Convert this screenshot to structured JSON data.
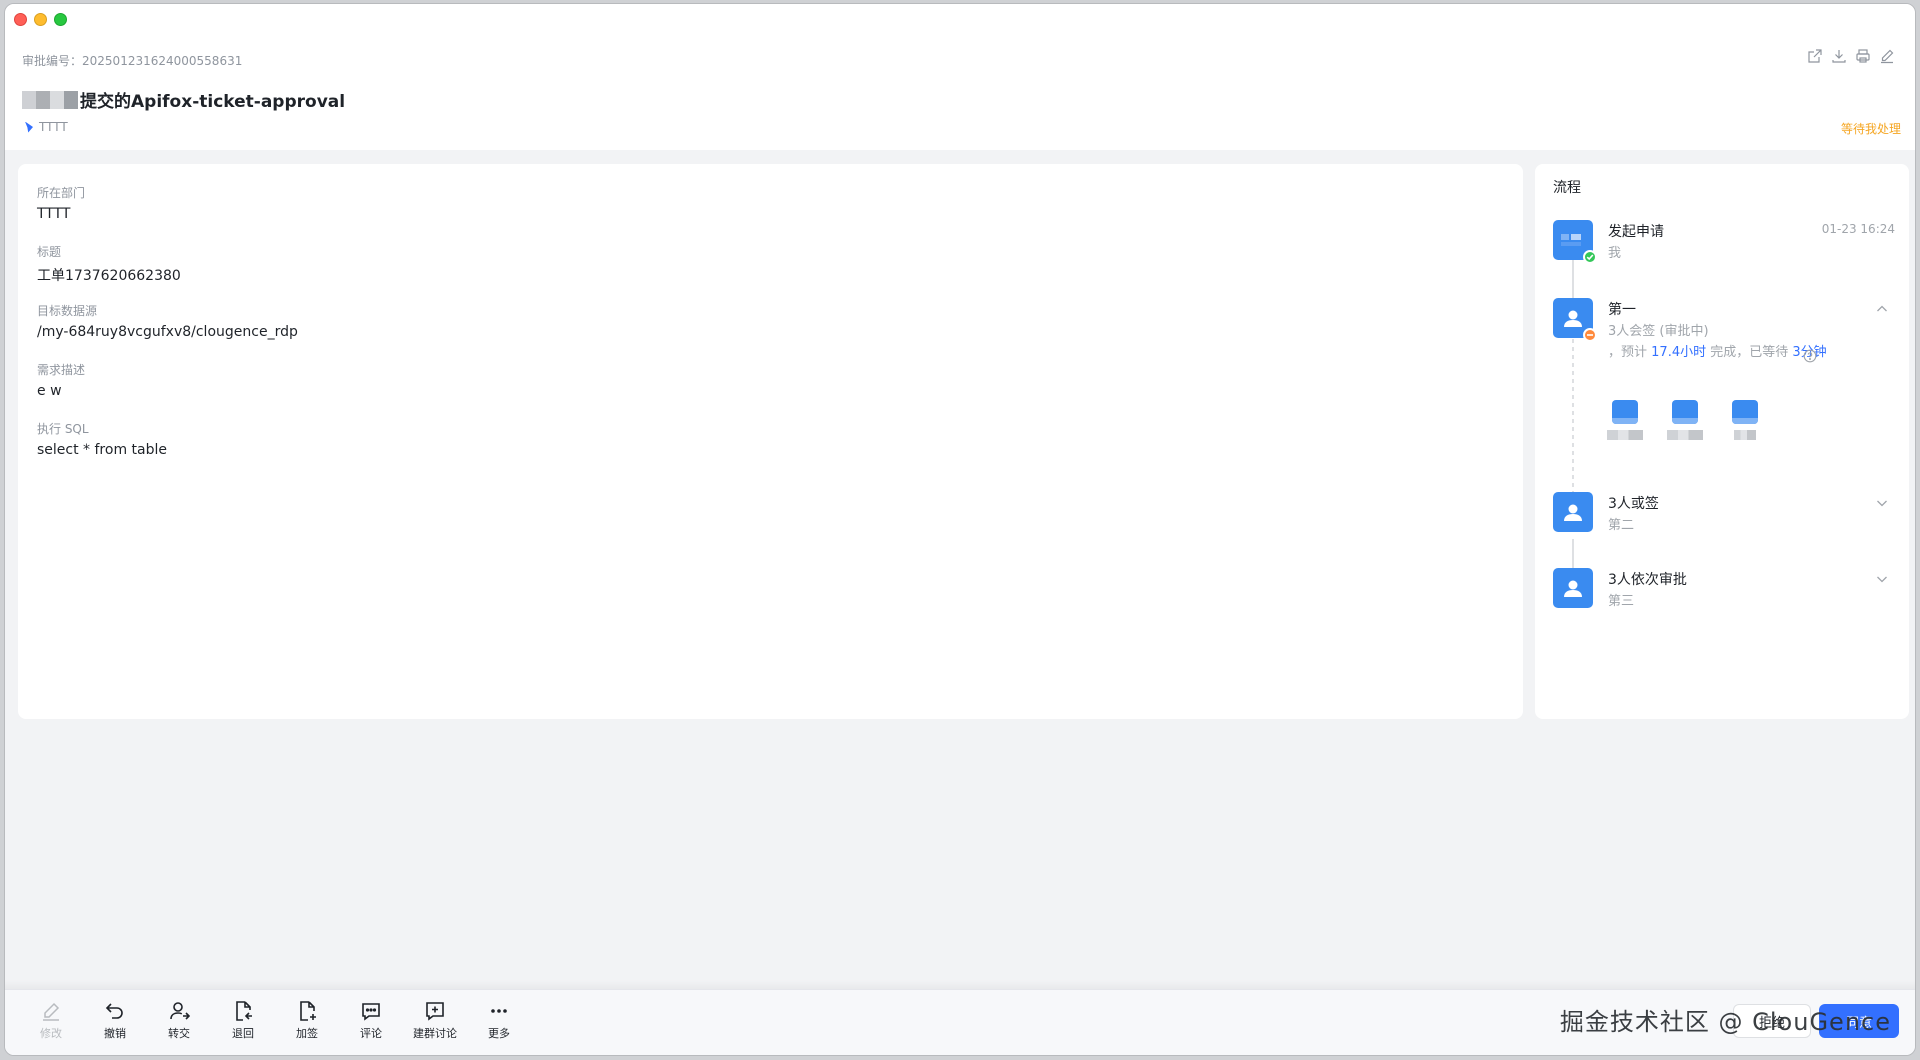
{
  "header": {
    "serial_label": "审批编号：",
    "serial_value": "202501231624000558631",
    "title": "提交的Apifox-ticket-approval",
    "department": "TTTT",
    "status": "等待我处理"
  },
  "form": {
    "fields": [
      {
        "label": "所在部门",
        "value": "TTTT"
      },
      {
        "label": "标题",
        "value": "工单1737620662380"
      },
      {
        "label": "目标数据源",
        "value": "/my-684ruy8vcgufxv8/clougence_rdp"
      },
      {
        "label": "需求描述",
        "value": "e w"
      },
      {
        "label": "执行 SQL",
        "value": "select * from table"
      }
    ]
  },
  "flow": {
    "title": "流程",
    "nodes": [
      {
        "name": "发起申请",
        "sub": "我",
        "time": "01-23 16:24"
      },
      {
        "name": "第一",
        "sub": "3人会签 (审批中)",
        "estimate": {
          "p1": "，预计",
          "v1": "17.4小时",
          "p2": "完成，已等待",
          "v2": "3分钟"
        }
      },
      {
        "name": "3人或签",
        "sub": "第二"
      },
      {
        "name": "3人依次审批",
        "sub": "第三"
      }
    ]
  },
  "actions": [
    {
      "label": "修改",
      "icon": "edit-icon"
    },
    {
      "label": "撤销",
      "icon": "undo-icon"
    },
    {
      "label": "转交",
      "icon": "transfer-icon"
    },
    {
      "label": "退回",
      "icon": "return-icon"
    },
    {
      "label": "加签",
      "icon": "add-sign-icon"
    },
    {
      "label": "评论",
      "icon": "comment-icon"
    },
    {
      "label": "建群讨论",
      "icon": "group-chat-icon"
    },
    {
      "label": "更多",
      "icon": "more-icon"
    }
  ],
  "buttons": {
    "reject": "拒绝",
    "approve": "同意"
  },
  "watermark": "掘金技术社区 @ ClouGence",
  "colors": {
    "accent": "#3370ff",
    "pending": "#f5a623",
    "success": "#34c759"
  }
}
